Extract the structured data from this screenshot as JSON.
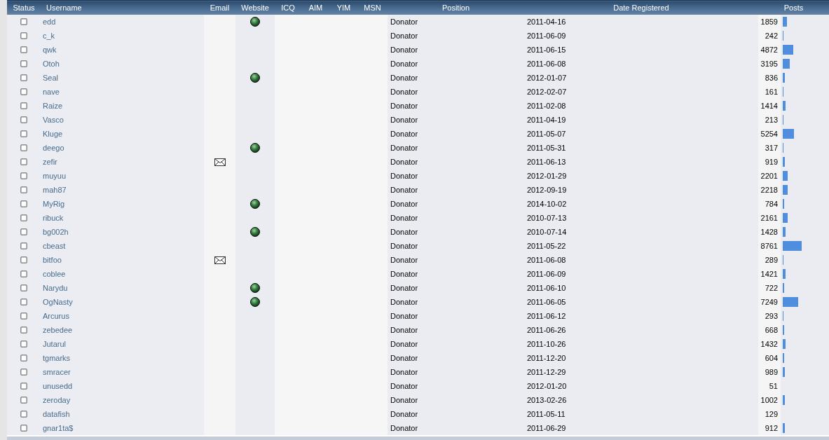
{
  "table": {
    "columns": [
      "Status",
      "Username",
      "Email",
      "Website",
      "ICQ",
      "AIM",
      "YIM",
      "MSN",
      "Position",
      "Date Registered",
      "Posts"
    ],
    "rows": [
      {
        "username": "edd",
        "email": false,
        "website": true,
        "position": "Donator",
        "registered": "2011-04-16",
        "posts": "1859",
        "level": 0.095
      },
      {
        "username": "c_k",
        "email": false,
        "website": false,
        "position": "Donator",
        "registered": "2011-06-09",
        "posts": "242",
        "level": 0.012
      },
      {
        "username": "qwk",
        "email": false,
        "website": false,
        "position": "Donator",
        "registered": "2011-06-15",
        "posts": "4872",
        "level": 0.25
      },
      {
        "username": "Otoh",
        "email": false,
        "website": false,
        "position": "Donator",
        "registered": "2011-06-08",
        "posts": "3195",
        "level": 0.164
      },
      {
        "username": "Seal",
        "email": false,
        "website": true,
        "position": "Donator",
        "registered": "2012-01-07",
        "posts": "836",
        "level": 0.043
      },
      {
        "username": "nave",
        "email": false,
        "website": false,
        "position": "Donator",
        "registered": "2012-02-07",
        "posts": "161",
        "level": 0.008
      },
      {
        "username": "Raize",
        "email": false,
        "website": false,
        "position": "Donator",
        "registered": "2011-02-08",
        "posts": "1414",
        "level": 0.073
      },
      {
        "username": "Vasco",
        "email": false,
        "website": false,
        "position": "Donator",
        "registered": "2011-04-19",
        "posts": "213",
        "level": 0.011
      },
      {
        "username": "Kluge",
        "email": false,
        "website": false,
        "position": "Donator",
        "registered": "2011-05-07",
        "posts": "5254",
        "level": 0.269
      },
      {
        "username": "deego",
        "email": false,
        "website": true,
        "position": "Donator",
        "registered": "2011-05-31",
        "posts": "317",
        "level": 0.016
      },
      {
        "username": "zefir",
        "email": true,
        "website": false,
        "position": "Donator",
        "registered": "2011-06-13",
        "posts": "919",
        "level": 0.047
      },
      {
        "username": "muyuu",
        "email": false,
        "website": false,
        "position": "Donator",
        "registered": "2012-01-29",
        "posts": "2201",
        "level": 0.113
      },
      {
        "username": "mah87",
        "email": false,
        "website": false,
        "position": "Donator",
        "registered": "2012-09-19",
        "posts": "2218",
        "level": 0.114
      },
      {
        "username": "MyRig",
        "email": false,
        "website": true,
        "position": "Donator",
        "registered": "2014-10-02",
        "posts": "784",
        "level": 0.04
      },
      {
        "username": "ribuck",
        "email": false,
        "website": false,
        "position": "Donator",
        "registered": "2010-07-13",
        "posts": "2161",
        "level": 0.111
      },
      {
        "username": "bg002h",
        "email": false,
        "website": true,
        "position": "Donator",
        "registered": "2010-07-14",
        "posts": "1428",
        "level": 0.073
      },
      {
        "username": "cbeast",
        "email": false,
        "website": false,
        "position": "Donator",
        "registered": "2011-05-22",
        "posts": "8761",
        "level": 0.449
      },
      {
        "username": "bitfoo",
        "email": true,
        "website": false,
        "position": "Donator",
        "registered": "2011-06-08",
        "posts": "289",
        "level": 0.015
      },
      {
        "username": "coblee",
        "email": false,
        "website": false,
        "position": "Donator",
        "registered": "2011-06-09",
        "posts": "1421",
        "level": 0.073
      },
      {
        "username": "Narydu",
        "email": false,
        "website": true,
        "position": "Donator",
        "registered": "2011-06-10",
        "posts": "722",
        "level": 0.037
      },
      {
        "username": "OgNasty",
        "email": false,
        "website": true,
        "position": "Donator",
        "registered": "2011-06-05",
        "posts": "7249",
        "level": 0.372
      },
      {
        "username": "Arcurus",
        "email": false,
        "website": false,
        "position": "Donator",
        "registered": "2011-06-12",
        "posts": "293",
        "level": 0.015
      },
      {
        "username": "zebedee",
        "email": false,
        "website": false,
        "position": "Donator",
        "registered": "2011-06-26",
        "posts": "668",
        "level": 0.034
      },
      {
        "username": "Jutarul",
        "email": false,
        "website": false,
        "position": "Donator",
        "registered": "2011-10-26",
        "posts": "1432",
        "level": 0.073
      },
      {
        "username": "tgmarks",
        "email": false,
        "website": false,
        "position": "Donator",
        "registered": "2011-12-20",
        "posts": "604",
        "level": 0.031
      },
      {
        "username": "smracer",
        "email": false,
        "website": false,
        "position": "Donator",
        "registered": "2011-12-29",
        "posts": "989",
        "level": 0.051
      },
      {
        "username": "unusedd",
        "email": false,
        "website": false,
        "position": "Donator",
        "registered": "2012-01-20",
        "posts": "51"
      },
      {
        "username": "zeroday",
        "email": false,
        "website": false,
        "position": "Donator",
        "registered": "2013-02-26",
        "posts": "1002",
        "level": 0.051
      },
      {
        "username": "datafish",
        "email": false,
        "website": false,
        "position": "Donator",
        "registered": "2011-05-11",
        "posts": "129"
      },
      {
        "username": "gnar1ta$",
        "email": false,
        "website": false,
        "position": "Donator",
        "registered": "2011-06-29",
        "posts": "912",
        "level": 0.047
      }
    ]
  }
}
